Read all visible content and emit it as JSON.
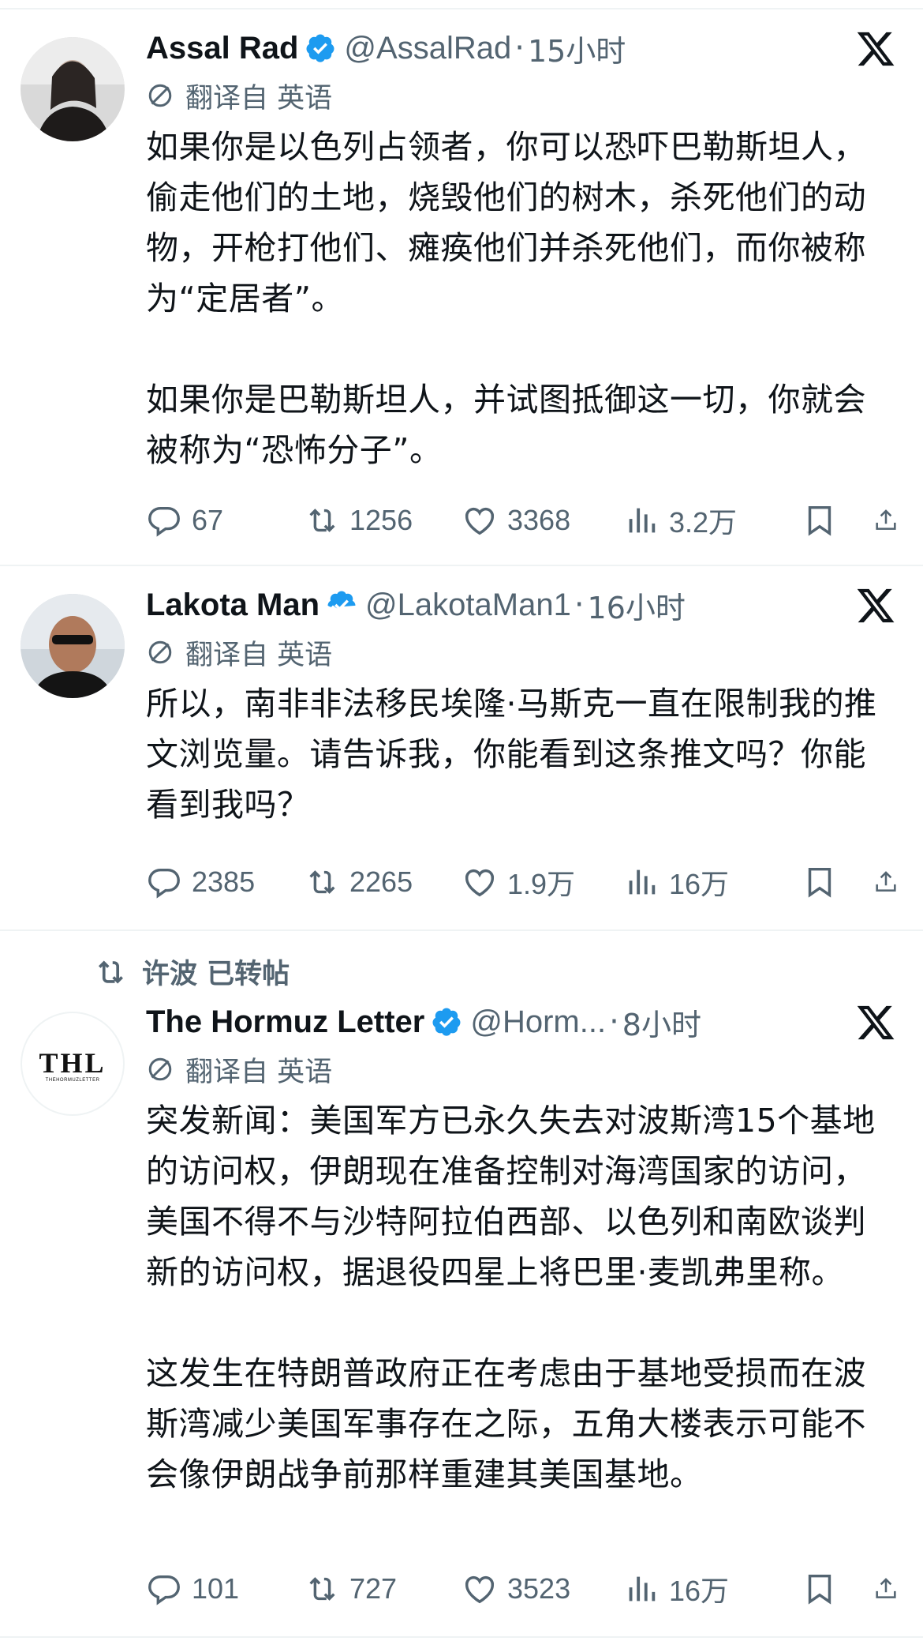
{
  "tweets": [
    {
      "name": "Assal Rad",
      "handle": "@AssalRad",
      "time": "15小时",
      "translate_label": "翻译自 英语",
      "text": "如果你是以色列占领者，你可以恐吓巴勒斯坦人，偷走他们的土地，烧毁他们的树木，杀死他们的动物，开枪打他们、瘫痪他们并杀死他们，而你被称为“定居者”。\n\n如果你是巴勒斯坦人，并试图抵御这一切，你就会被称为“恐怖分子”。",
      "replies": "67",
      "retweets": "1256",
      "likes": "3368",
      "views": "3.2万"
    },
    {
      "name": "Lakota Man",
      "handle": "@LakotaMan1",
      "time": "16小时",
      "translate_label": "翻译自 英语",
      "text": "所以，南非非法移民埃隆·马斯克一直在限制我的推文浏览量。请告诉我，你能看到这条推文吗？你能看到我吗？",
      "replies": "2385",
      "retweets": "2265",
      "likes": "1.9万",
      "views": "16万"
    },
    {
      "retweeted_by": "许波 已转帖",
      "name": "The Hormuz Letter",
      "handle": "@Horm...",
      "time": "8小时",
      "avatar_text": "THL",
      "avatar_subtext": "THEHORMUZLETTER",
      "translate_label": "翻译自 英语",
      "text": "突发新闻：美国军方已永久失去对波斯湾15个基地的访问权，伊朗现在准备控制对海湾国家的访问，美国不得不与沙特阿拉伯西部、以色列和南欧谈判新的访问权，据退役四星上将巴里·麦凯弗里称。\n\n这发生在特朗普政府正在考虑由于基地受损而在波斯湾减少美国军事存在之际，五角大楼表示可能不会像伊朗战争前那样重建其美国基地。",
      "replies": "101",
      "retweets": "727",
      "likes": "3523",
      "views": "16万"
    }
  ],
  "colors": {
    "verified": "#1d9bf0",
    "secondary_text": "#536471",
    "divider": "#eff3f4"
  },
  "icons": [
    "reply-icon",
    "retweet-icon",
    "like-icon",
    "views-icon",
    "bookmark-icon",
    "share-icon",
    "x-logo-icon",
    "translate-icon",
    "verified-icon"
  ]
}
